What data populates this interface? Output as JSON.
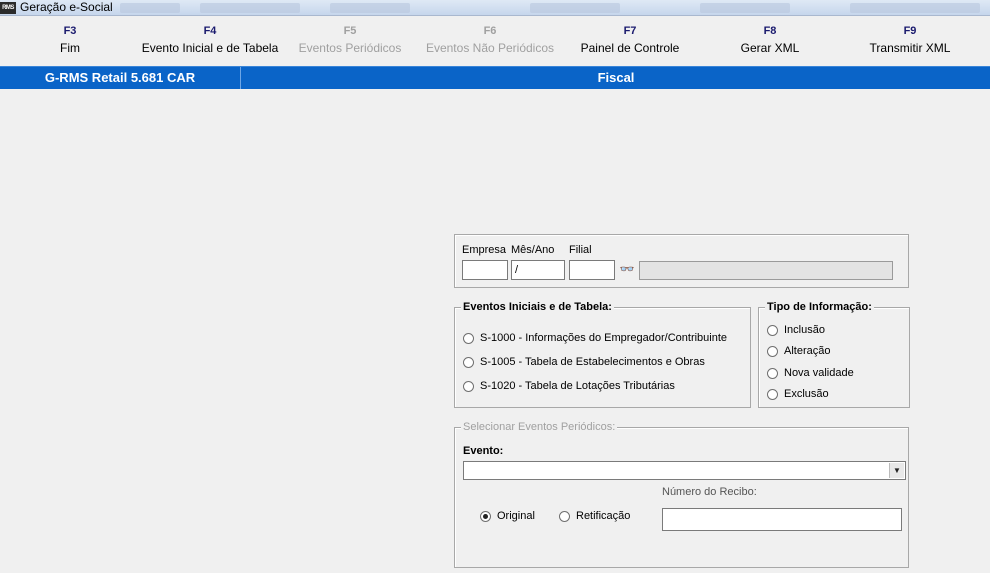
{
  "window": {
    "title": "Geração e-Social",
    "app_icon": "RMS"
  },
  "fkeys": [
    {
      "key": "F3",
      "label": "Fim",
      "enabled": true
    },
    {
      "key": "F4",
      "label": "Evento Inicial e de Tabela",
      "enabled": true
    },
    {
      "key": "F5",
      "label": "Eventos Periódicos",
      "enabled": false
    },
    {
      "key": "F6",
      "label": "Eventos Não Periódicos",
      "enabled": false
    },
    {
      "key": "F7",
      "label": "Painel de Controle",
      "enabled": true
    },
    {
      "key": "F8",
      "label": "Gerar XML",
      "enabled": true
    },
    {
      "key": "F9",
      "label": "Transmitir XML",
      "enabled": true
    }
  ],
  "infobar": {
    "product": "G-RMS Retail 5.681 CAR",
    "module": "Fiscal"
  },
  "filters": {
    "empresa_label": "Empresa",
    "mesano_label": "Mês/Ano",
    "filial_label": "Filial",
    "empresa_value": "",
    "mesano_value": "/",
    "filial_value": "",
    "description_value": "",
    "search_icon": "binoculars-icon"
  },
  "eventos_iniciais": {
    "title": "Eventos Iniciais e de Tabela:",
    "options": [
      {
        "label": "S-1000 - Informações do Empregador/Contribuinte",
        "checked": false
      },
      {
        "label": "S-1005 - Tabela de Estabelecimentos e Obras",
        "checked": false
      },
      {
        "label": "S-1020 - Tabela de Lotações Tributárias",
        "checked": false
      }
    ]
  },
  "tipo_informacao": {
    "title": "Tipo de Informação:",
    "options": [
      {
        "label": "Inclusão",
        "checked": false
      },
      {
        "label": "Alteração",
        "checked": false
      },
      {
        "label": "Nova validade",
        "checked": false
      },
      {
        "label": "Exclusão",
        "checked": false
      }
    ]
  },
  "eventos_periodicos": {
    "title": "Selecionar Eventos Periódicos:",
    "evento_label": "Evento:",
    "evento_value": "",
    "numero_recibo_label": "Número do Recibo:",
    "numero_recibo_value": "",
    "original_label": "Original",
    "original_checked": true,
    "retificacao_label": "Retificação",
    "retificacao_checked": false
  },
  "colors": {
    "infobar": "#0a64c8",
    "background": "#f0f0f0",
    "fkey": "#1a1a6e"
  }
}
